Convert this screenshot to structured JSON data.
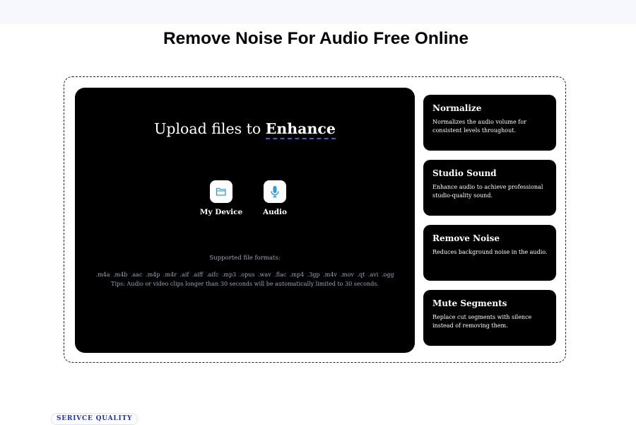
{
  "page": {
    "title": "Remove Noise For Audio Free Online"
  },
  "upload": {
    "heading_prefix": "Upload files to ",
    "heading_accent": "Enhance",
    "sources": [
      {
        "label": "My Device",
        "icon": "folder-icon"
      },
      {
        "label": "Audio",
        "icon": "microphone-icon"
      }
    ],
    "formats_title": "Supported file formats:",
    "formats": ".m4a .m4b .aac .m4p .m4r .aif .aiff .aifc .mp3 .opus .wav .flac .mp4 .3gp .m4v .mov .qt .avi .ogg",
    "tip": "Tips: Audio or video clips longer than 30 seconds will be automatically limited to 30 seconds."
  },
  "features": [
    {
      "title": "Normalize",
      "desc": "Normalizes the audio volume for consistent levels throughout."
    },
    {
      "title": "Studio Sound",
      "desc": "Enhance audio to achieve professional studio-quality sound."
    },
    {
      "title": "Remove Noise",
      "desc": "Reduces background noise in the audio."
    },
    {
      "title": "Mute Segments",
      "desc": "Replace cut segments with silence instead of removing them."
    }
  ],
  "badge": {
    "label": "SERIVCE QUALITY"
  },
  "colors": {
    "accent_underline": "#3b5bdb",
    "icon_blue": "#2f9bd8",
    "badge_text": "#1a2fc9",
    "panel_bg": "#000000"
  }
}
